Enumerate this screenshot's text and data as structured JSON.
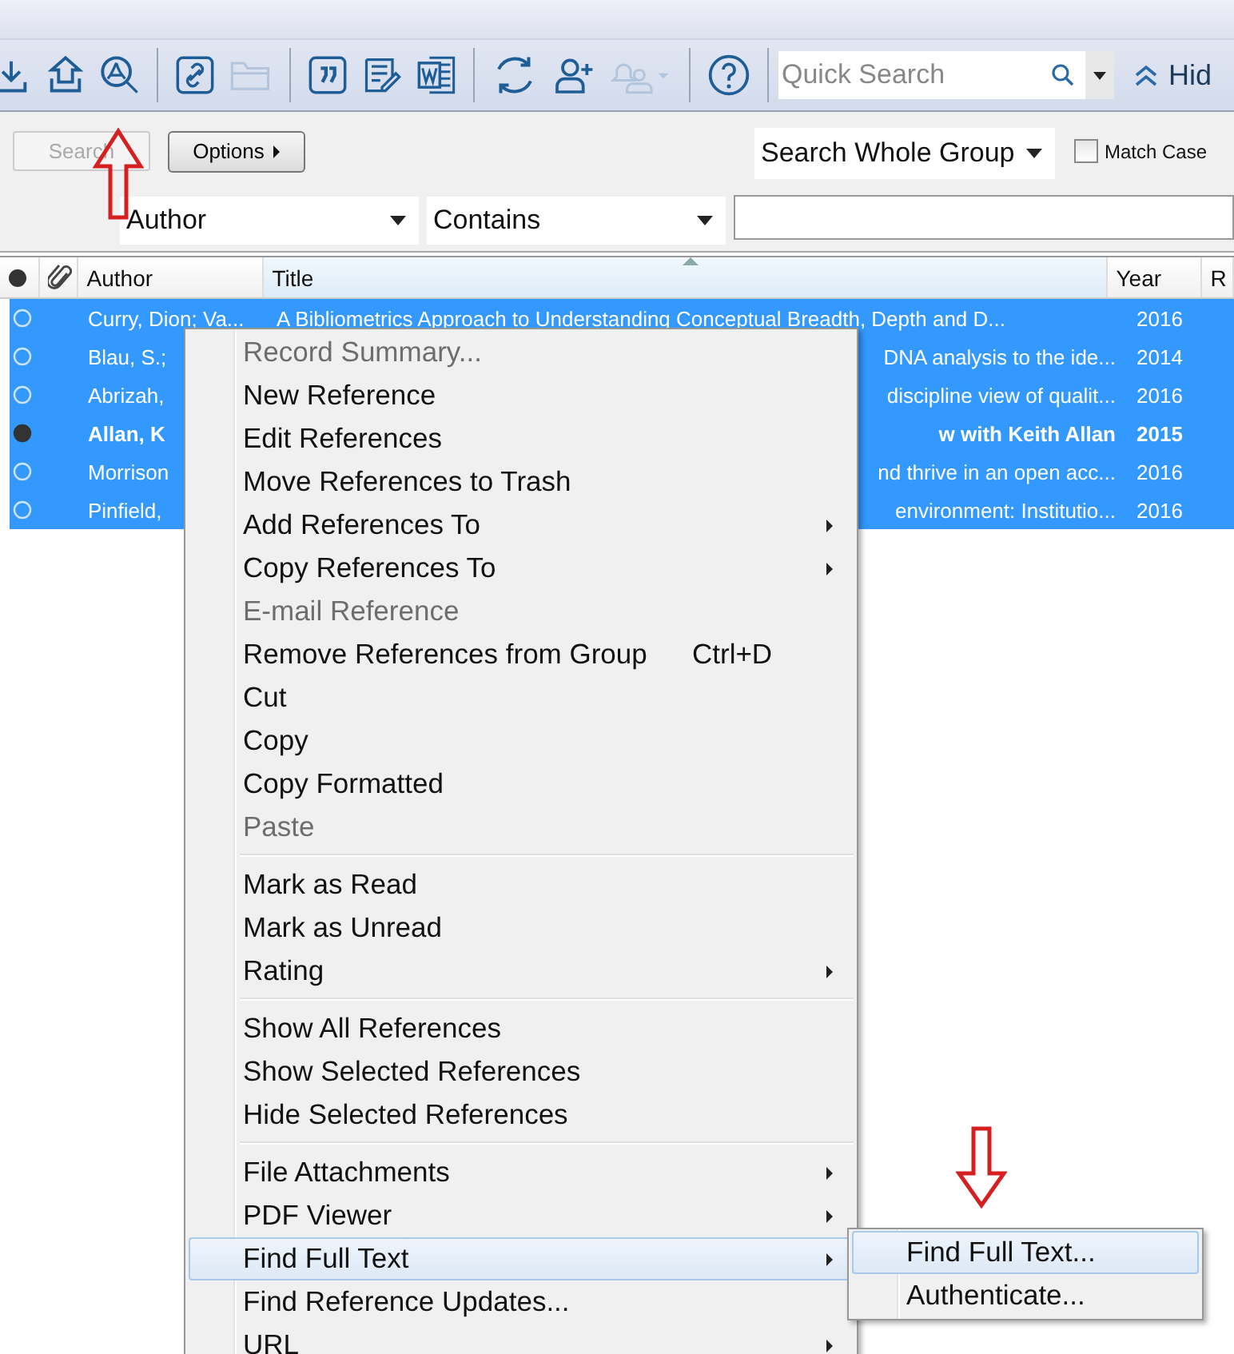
{
  "toolbar": {
    "buttons": [
      {
        "kind": "import",
        "disabled": false
      },
      {
        "kind": "export",
        "disabled": false
      },
      {
        "kind": "pdf",
        "disabled": false
      },
      {
        "kind": "separator"
      },
      {
        "kind": "link",
        "disabled": false
      },
      {
        "kind": "folder",
        "disabled": true
      },
      {
        "kind": "separator"
      },
      {
        "kind": "quote",
        "disabled": false
      },
      {
        "kind": "edit",
        "disabled": false
      },
      {
        "kind": "word",
        "disabled": false
      },
      {
        "kind": "separator"
      },
      {
        "kind": "sync",
        "disabled": false
      },
      {
        "kind": "adduser",
        "disabled": false
      },
      {
        "kind": "notify",
        "disabled": true
      },
      {
        "kind": "separator"
      },
      {
        "kind": "help",
        "disabled": false
      },
      {
        "kind": "separator"
      }
    ],
    "quick_search": {
      "placeholder": "Quick Search"
    },
    "hide_label": "Hid"
  },
  "search_panel": {
    "search_button": {
      "label": "Search",
      "disabled": true
    },
    "options_button": {
      "label": "Options"
    },
    "scope": "Search Whole Group",
    "match_case": {
      "label": "Match Case",
      "checked": false
    },
    "field": "Author",
    "operator": "Contains"
  },
  "table": {
    "columns": [
      {
        "kind": "read"
      },
      {
        "kind": "attach"
      },
      {
        "kind": "text",
        "label": "Author",
        "sorted": false
      },
      {
        "kind": "text",
        "label": "Title",
        "sorted": true
      },
      {
        "kind": "text",
        "label": "Year",
        "sorted": false
      },
      {
        "kind": "text",
        "label": "R",
        "sorted": false
      }
    ],
    "rows": [
      {
        "author": "Curry, Dion; Va...",
        "title": "A Bibliometrics Approach to Understanding Conceptual Breadth, Depth and D...",
        "year": "2016",
        "unread": false,
        "selected": true,
        "covered": false
      },
      {
        "author": "Blau, S.;",
        "title": "DNA analysis to the ide...",
        "year": "2014",
        "unread": false,
        "selected": true,
        "covered": true
      },
      {
        "author": "Abrizah,",
        "title": "discipline view of qualit...",
        "year": "2016",
        "unread": false,
        "selected": true,
        "covered": true
      },
      {
        "author": "Allan, K",
        "title": "w with Keith Allan",
        "year": "2015",
        "unread": true,
        "selected": true,
        "covered": true
      },
      {
        "author": "Morrison",
        "title": "nd thrive in an open acc...",
        "year": "2016",
        "unread": false,
        "selected": true,
        "covered": true
      },
      {
        "author": "Pinfield,",
        "title": "environment: Institutio...",
        "year": "2016",
        "unread": false,
        "selected": true,
        "covered": true
      }
    ]
  },
  "context_menu": {
    "items": [
      {
        "kind": "item",
        "label": "Record Summary...",
        "disabled": true,
        "submenu": false,
        "selected": false
      },
      {
        "kind": "item",
        "label": "New Reference",
        "disabled": false,
        "submenu": false,
        "selected": false
      },
      {
        "kind": "item",
        "label": "Edit References",
        "disabled": false,
        "submenu": false,
        "selected": false
      },
      {
        "kind": "item",
        "label": "Move References to Trash",
        "disabled": false,
        "submenu": false,
        "selected": false
      },
      {
        "kind": "item",
        "label": "Add References To",
        "disabled": false,
        "submenu": true,
        "selected": false
      },
      {
        "kind": "item",
        "label": "Copy References To",
        "disabled": false,
        "submenu": true,
        "selected": false
      },
      {
        "kind": "item",
        "label": "E-mail Reference",
        "disabled": true,
        "submenu": false,
        "selected": false
      },
      {
        "kind": "item",
        "label": "Remove References from Group",
        "shortcut": "Ctrl+D",
        "disabled": false,
        "submenu": false,
        "selected": false
      },
      {
        "kind": "item",
        "label": "Cut",
        "disabled": false,
        "submenu": false,
        "selected": false
      },
      {
        "kind": "item",
        "label": "Copy",
        "disabled": false,
        "submenu": false,
        "selected": false
      },
      {
        "kind": "item",
        "label": "Copy Formatted",
        "disabled": false,
        "submenu": false,
        "selected": false
      },
      {
        "kind": "item",
        "label": "Paste",
        "disabled": true,
        "submenu": false,
        "selected": false
      },
      {
        "kind": "separator"
      },
      {
        "kind": "item",
        "label": "Mark as Read",
        "disabled": false,
        "submenu": false,
        "selected": false
      },
      {
        "kind": "item",
        "label": "Mark as Unread",
        "disabled": false,
        "submenu": false,
        "selected": false
      },
      {
        "kind": "item",
        "label": "Rating",
        "disabled": false,
        "submenu": true,
        "selected": false
      },
      {
        "kind": "separator"
      },
      {
        "kind": "item",
        "label": "Show All References",
        "disabled": false,
        "submenu": false,
        "selected": false
      },
      {
        "kind": "item",
        "label": "Show Selected References",
        "disabled": false,
        "submenu": false,
        "selected": false
      },
      {
        "kind": "item",
        "label": "Hide Selected References",
        "disabled": false,
        "submenu": false,
        "selected": false
      },
      {
        "kind": "separator"
      },
      {
        "kind": "item",
        "label": "File Attachments",
        "disabled": false,
        "submenu": true,
        "selected": false
      },
      {
        "kind": "item",
        "label": "PDF Viewer",
        "disabled": false,
        "submenu": true,
        "selected": false
      },
      {
        "kind": "item",
        "label": "Find Full Text",
        "disabled": false,
        "submenu": true,
        "selected": true
      },
      {
        "kind": "item",
        "label": "Find Reference Updates...",
        "disabled": false,
        "submenu": false,
        "selected": false
      },
      {
        "kind": "item",
        "label": "URL",
        "disabled": false,
        "submenu": true,
        "selected": false
      }
    ]
  },
  "submenu": {
    "items": [
      {
        "label": "Find Full Text...",
        "selected": true
      },
      {
        "label": "Authenticate...",
        "selected": false
      }
    ]
  }
}
